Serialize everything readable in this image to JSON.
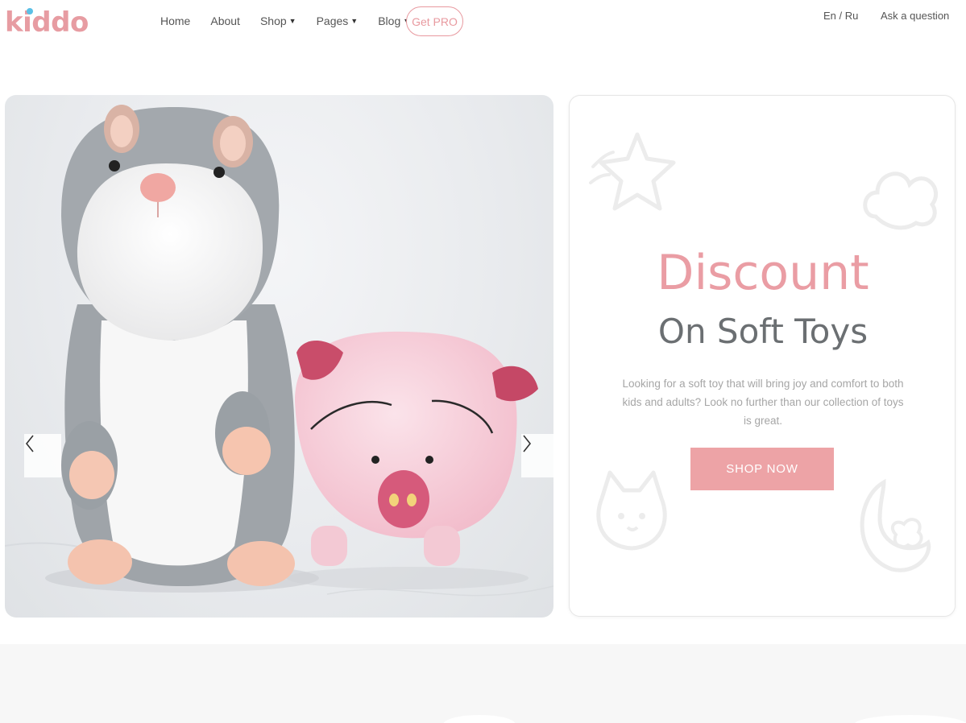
{
  "header": {
    "logo": "kiddo",
    "nav": [
      {
        "label": "Home",
        "dropdown": false
      },
      {
        "label": "About",
        "dropdown": false
      },
      {
        "label": "Shop",
        "dropdown": true
      },
      {
        "label": "Pages",
        "dropdown": true
      },
      {
        "label": "Blog",
        "dropdown": true
      }
    ],
    "pro_button": "Get PRO",
    "language": "En / Ru",
    "ask": "Ask a question"
  },
  "slider": {
    "prev_icon": "chevron-left-icon",
    "next_icon": "chevron-right-icon"
  },
  "promo": {
    "title": "Discount",
    "subtitle": "On Soft Toys",
    "description": "Looking for a soft toy that will bring joy and comfort to both kids and adults? Look no further than our collection of toys is great.",
    "button": "SHOP NOW"
  },
  "colors": {
    "accent": "#eda3a6",
    "logo": "#e79ca2",
    "title": "#ea9da4",
    "subtitle": "#6b6f72"
  }
}
